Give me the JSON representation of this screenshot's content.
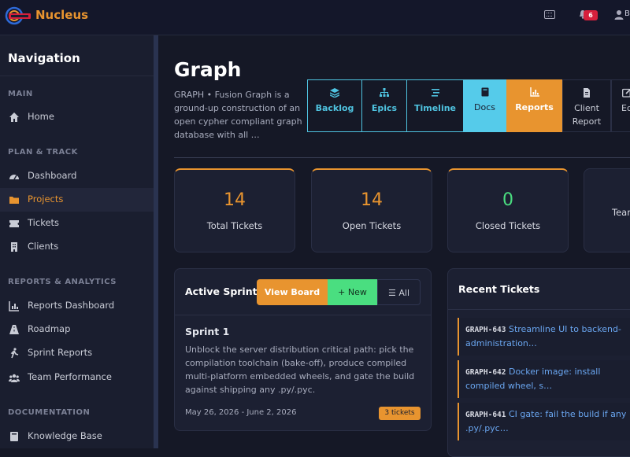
{
  "app": {
    "name": "Nucleus",
    "notifications": "6",
    "user_initial": "B"
  },
  "sidebar": {
    "heading": "Navigation",
    "sections": [
      {
        "title": "MAIN",
        "items": [
          {
            "label": "Home",
            "icon": "home-icon"
          }
        ]
      },
      {
        "title": "PLAN & TRACK",
        "items": [
          {
            "label": "Dashboard",
            "icon": "dashboard-icon"
          },
          {
            "label": "Projects",
            "icon": "folder-icon",
            "active": true
          },
          {
            "label": "Tickets",
            "icon": "ticket-icon"
          },
          {
            "label": "Clients",
            "icon": "building-icon"
          }
        ]
      },
      {
        "title": "REPORTS & ANALYTICS",
        "items": [
          {
            "label": "Reports Dashboard",
            "icon": "chart-icon"
          },
          {
            "label": "Roadmap",
            "icon": "road-icon"
          },
          {
            "label": "Sprint Reports",
            "icon": "runner-icon"
          },
          {
            "label": "Team Performance",
            "icon": "users-icon"
          }
        ]
      },
      {
        "title": "DOCUMENTATION",
        "items": [
          {
            "label": "Knowledge Base",
            "icon": "book-icon"
          }
        ]
      }
    ]
  },
  "project": {
    "title": "Graph",
    "description": "GRAPH • Fusion Graph is a ground-up construction of an open cypher compliant graph database with all …"
  },
  "tabs": [
    {
      "label": "Backlog",
      "icon": "layers-icon"
    },
    {
      "label": "Epics",
      "icon": "sitemap-icon"
    },
    {
      "label": "Timeline",
      "icon": "bars-icon"
    },
    {
      "label": "Docs",
      "icon": "book-icon"
    },
    {
      "label": "Reports",
      "icon": "chart-icon"
    },
    {
      "label": "Client Report",
      "icon": "file-icon"
    },
    {
      "label": "Ed",
      "icon": "edit-icon"
    }
  ],
  "stats": [
    {
      "value": "14",
      "label": "Total Tickets"
    },
    {
      "value": "14",
      "label": "Open Tickets"
    },
    {
      "value": "0",
      "label": "Closed Tickets"
    },
    {
      "value": "",
      "label": "Team"
    }
  ],
  "sprint_panel": {
    "title": "Active Sprint",
    "view_board": "View Board",
    "new_label": "New",
    "all_label": "All",
    "sprint_name": "Sprint 1",
    "sprint_description": "Unblock the server distribution critical path: pick the compilation toolchain (bake-off), produce compiled multi-platform embedded wheels, and gate the build against shipping any .py/.pyc.",
    "dates": "May 26, 2026 - June 2, 2026",
    "ticket_count": "3 tickets"
  },
  "recent_tickets": {
    "title": "Recent Tickets",
    "items": [
      {
        "id": "GRAPH-643",
        "text": "Streamline UI to backend-administration…"
      },
      {
        "id": "GRAPH-642",
        "text": "Docker image: install compiled wheel, s…"
      },
      {
        "id": "GRAPH-641",
        "text": "CI gate: fail the build if any .py/.pyc…"
      }
    ]
  },
  "colors": {
    "accent": "#e8942f",
    "cyan": "#55cbea",
    "green": "#4ade80",
    "link": "#6aa6f0",
    "bg": "#151826"
  }
}
